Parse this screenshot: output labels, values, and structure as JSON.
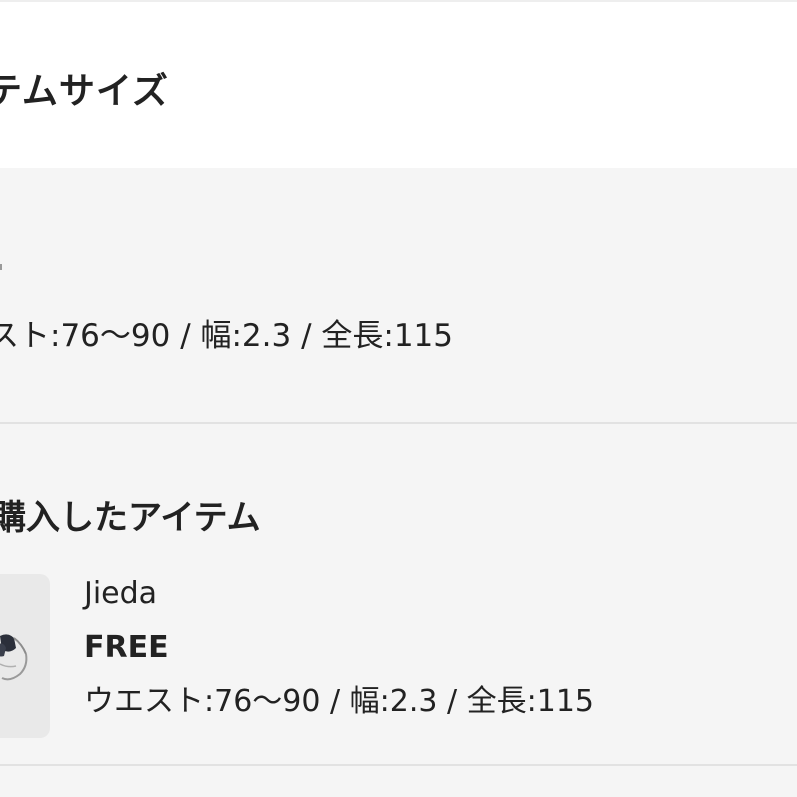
{
  "header": {
    "title": "テムサイズ"
  },
  "size_card": {
    "measurements": "スト:76～90 / 幅:2.3 / 全長:115"
  },
  "purchased": {
    "title": "購入したアイテム",
    "item": {
      "brand": "Jieda",
      "size": "FREE",
      "measurements": "ウエスト:76～90 / 幅:2.3 / 全長:115",
      "thumbnail_icon": "belt-product-photo"
    }
  }
}
